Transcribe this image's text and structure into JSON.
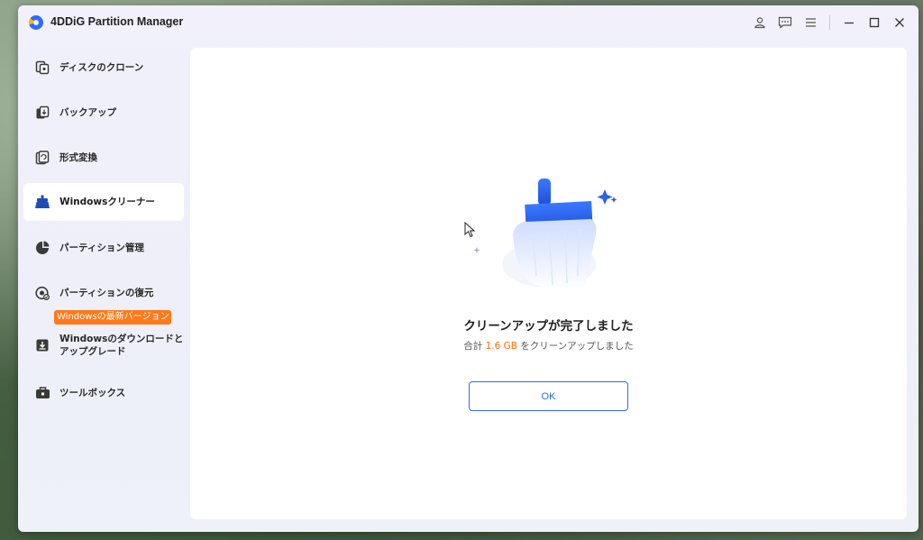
{
  "window": {
    "title": "4DDiG Partition Manager"
  },
  "titlebar_icons": [
    "account-icon",
    "feedback-icon",
    "menu-icon",
    "minimize-icon",
    "maximize-icon",
    "close-icon"
  ],
  "sidebar": {
    "items": [
      {
        "label": "ディスクのクローン",
        "icon": "clone-icon",
        "active": false
      },
      {
        "label": "バックアップ",
        "icon": "backup-icon",
        "active": false
      },
      {
        "label": "形式変換",
        "icon": "convert-icon",
        "active": false
      },
      {
        "label": "Windowsクリーナー",
        "icon": "cleaner-icon",
        "active": true
      },
      {
        "label": "パーティション管理",
        "icon": "pie-chart-icon",
        "active": false
      },
      {
        "label": "パーティションの復元",
        "icon": "recovery-icon",
        "active": false
      },
      {
        "label_line1": "Windowsのダウンロードと",
        "label_line2": "アップグレード",
        "icon": "download-icon",
        "active": false
      },
      {
        "label": "ツールボックス",
        "icon": "toolbox-icon",
        "active": false
      }
    ],
    "badge": "Windowsの最新バージョン"
  },
  "result": {
    "title": "クリーンアップが完了しました",
    "sub_prefix": "合計 ",
    "amount": "1.6 GB",
    "sub_suffix": " をクリーンアップしました",
    "ok_label": "OK"
  },
  "colors": {
    "accent": "#2b6aff",
    "badge": "#ff7a1a",
    "amount": "#ff6a00",
    "window_bg": "#f1f0fb",
    "content_bg": "#ffffff"
  }
}
